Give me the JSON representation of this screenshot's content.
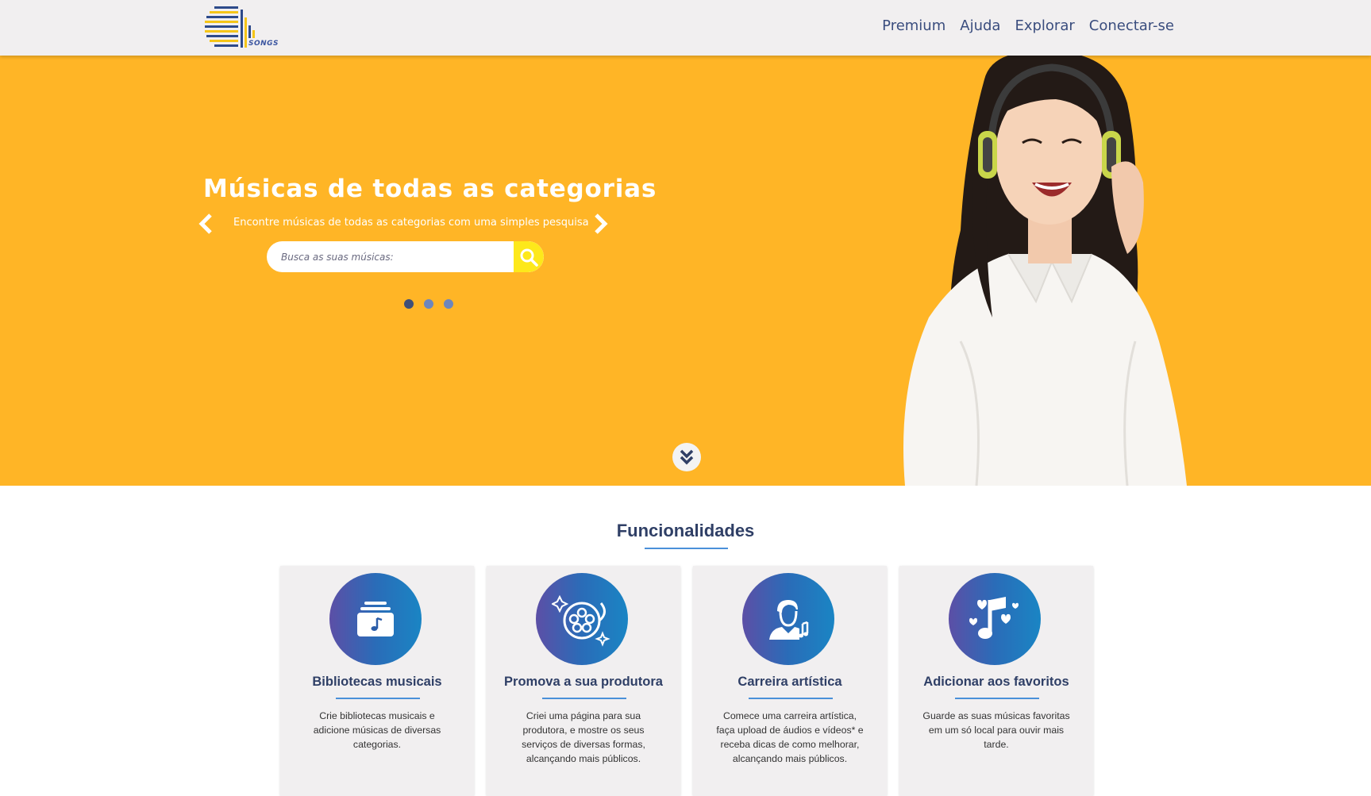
{
  "header": {
    "logo_text": "SONGS",
    "nav": [
      "Premium",
      "Ajuda",
      "Explorar",
      "Conectar-se"
    ]
  },
  "hero": {
    "title": "Músicas de todas as categorias",
    "subtitle": "Encontre músicas de todas as categorias com uma simples pesquisa",
    "search_placeholder": "Busca as suas músicas:",
    "slide_count": 3,
    "active_slide": 1
  },
  "features": {
    "title": "Funcionalidades",
    "cards": [
      {
        "icon": "music-library-icon",
        "title": "Bibliotecas musicais",
        "text": "Crie bibliotecas musicais e adicione músicas de diversas categorias."
      },
      {
        "icon": "film-reel-icon",
        "title": "Promova a sua produtora",
        "text": "Criei uma página para sua produtora, e mostre os seus serviços de diversas formas, alcançando mais públicos."
      },
      {
        "icon": "artist-icon",
        "title": "Carreira artística",
        "text": "Comece uma carreira artística, faça upload de áudios e vídeos* e receba dicas de como melhorar, alcançando mais públicos."
      },
      {
        "icon": "music-hearts-icon",
        "title": "Adicionar aos favoritos",
        "text": "Guarde as suas músicas favoritas em um só local para ouvir mais tarde."
      }
    ]
  },
  "colors": {
    "hero_bg": "#ffb526",
    "search_button": "#fde81b",
    "accent_blue": "#4a90d9",
    "text_dark": "#2f3f66"
  }
}
